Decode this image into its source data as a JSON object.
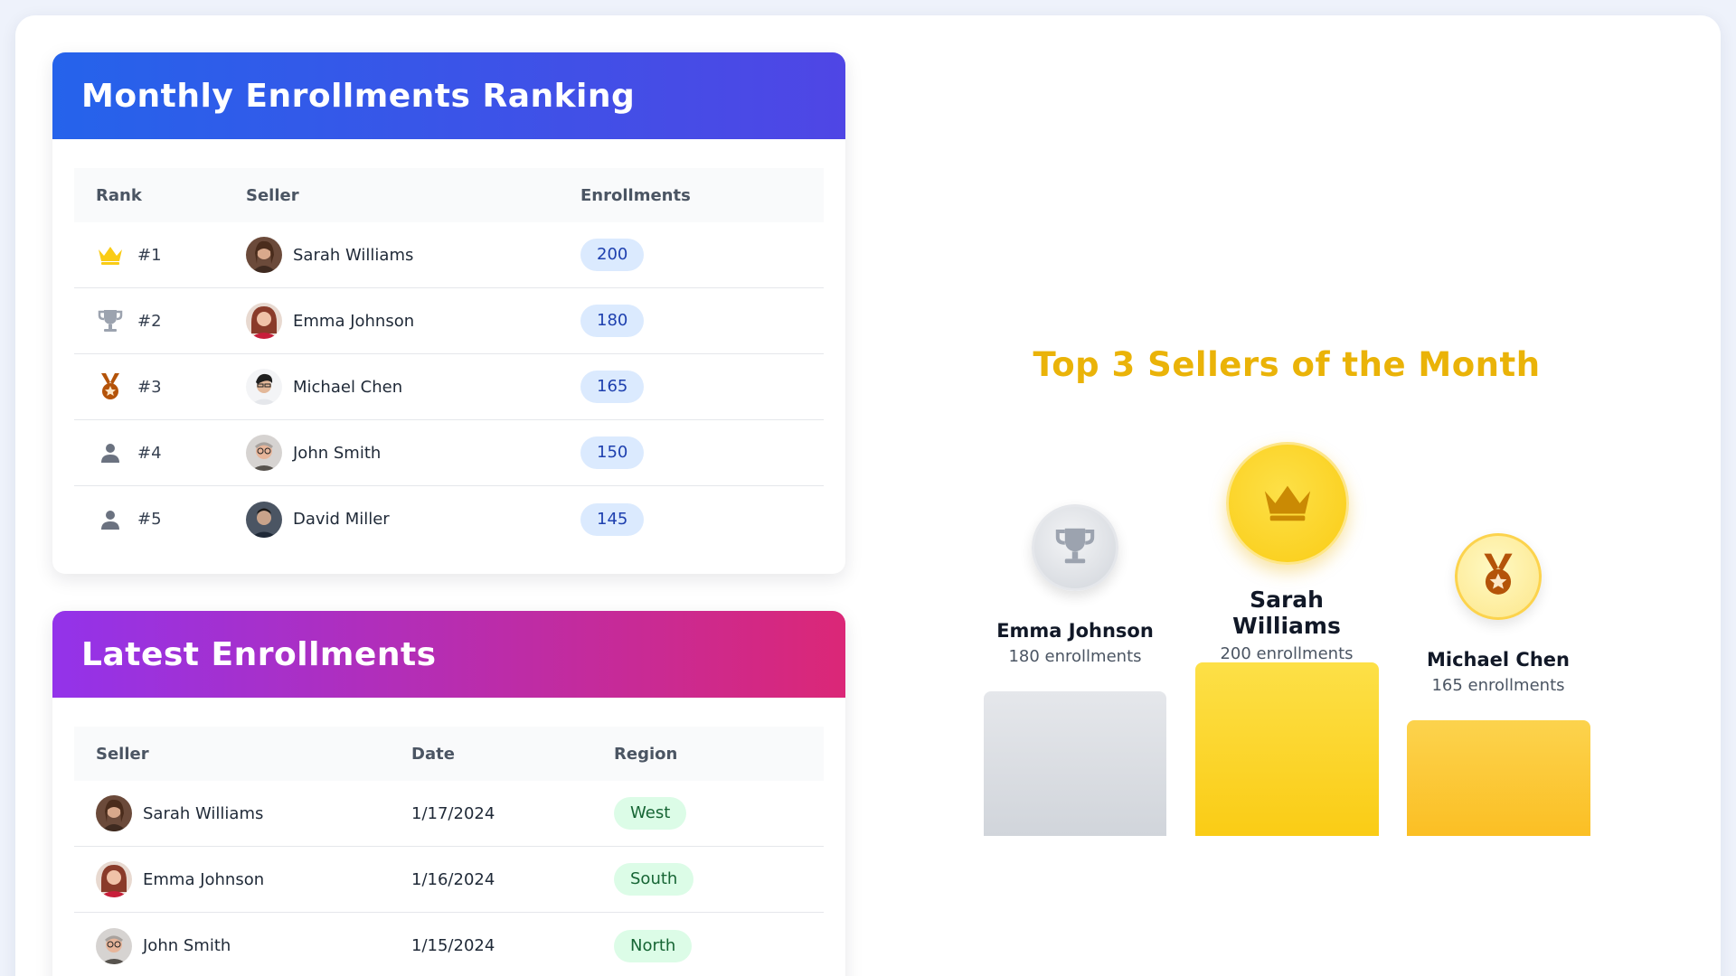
{
  "ranking": {
    "title": "Monthly Enrollments Ranking",
    "columns": [
      "Rank",
      "Seller",
      "Enrollments"
    ],
    "rows": [
      {
        "rank": "#1",
        "icon": "crown-icon",
        "seller": "Sarah Williams",
        "enrollments": "200"
      },
      {
        "rank": "#2",
        "icon": "trophy-icon",
        "seller": "Emma Johnson",
        "enrollments": "180"
      },
      {
        "rank": "#3",
        "icon": "medal-icon",
        "seller": "Michael Chen",
        "enrollments": "165"
      },
      {
        "rank": "#4",
        "icon": "user-icon",
        "seller": "John Smith",
        "enrollments": "150"
      },
      {
        "rank": "#5",
        "icon": "user-icon",
        "seller": "David Miller",
        "enrollments": "145"
      }
    ]
  },
  "latest": {
    "title": "Latest Enrollments",
    "columns": [
      "Seller",
      "Date",
      "Region"
    ],
    "rows": [
      {
        "seller": "Sarah Williams",
        "date": "1/17/2024",
        "region": "West"
      },
      {
        "seller": "Emma Johnson",
        "date": "1/16/2024",
        "region": "South"
      },
      {
        "seller": "John Smith",
        "date": "1/15/2024",
        "region": "North"
      }
    ]
  },
  "podium": {
    "title": "Top 3 Sellers of the Month",
    "first": {
      "name": "Sarah Williams",
      "sub": "200 enrollments",
      "icon": "crown-icon"
    },
    "second": {
      "name": "Emma Johnson",
      "sub": "180 enrollments",
      "icon": "trophy-icon"
    },
    "third": {
      "name": "Michael Chen",
      "sub": "165 enrollments",
      "icon": "medal-icon"
    }
  },
  "colors": {
    "gold": "#eab308",
    "silver": "#9ca3af",
    "bronze": "#b45309",
    "ranking_gradient": [
      "#2563eb",
      "#4f46e5"
    ],
    "latest_gradient": [
      "#9333ea",
      "#db2777"
    ]
  }
}
